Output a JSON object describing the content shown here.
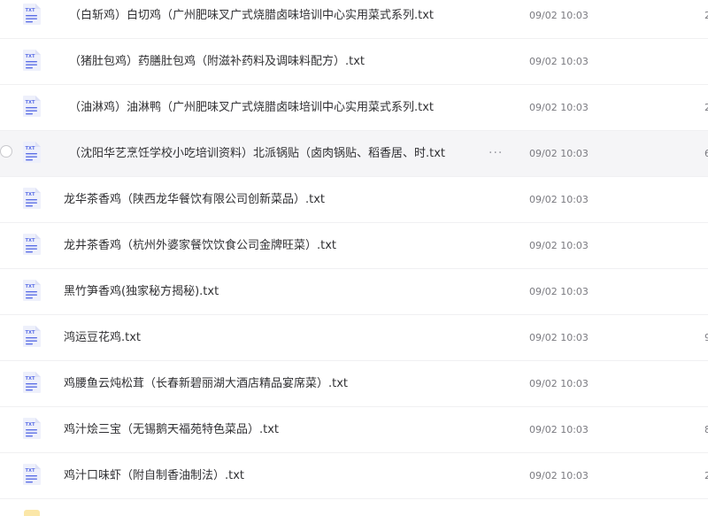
{
  "file_type_label": "TXT",
  "colors": {
    "icon_bg": "#eef0fb",
    "icon_accent": "#5b6ee6",
    "hover_bg": "#f5f5f7"
  },
  "more_glyph": "···",
  "files": [
    {
      "name": "（白斩鸡）白切鸡（广州肥味叉广式烧腊卤味培训中心实用菜式系列.txt",
      "time": "09/02 10:03",
      "size": "2"
    },
    {
      "name": "（猪肚包鸡）药膳肚包鸡（附滋补药料及调味料配方）.txt",
      "time": "09/02 10:03",
      "size": ""
    },
    {
      "name": "（油淋鸡）油淋鸭（广州肥味叉广式烧腊卤味培训中心实用菜式系列.txt",
      "time": "09/02 10:03",
      "size": "2"
    },
    {
      "name": "（沈阳华艺烹饪学校小吃培训资料）北派锅贴（卤肉锅贴、稻香居、时.txt",
      "time": "09/02 10:03",
      "size": "6"
    },
    {
      "name": "龙华茶香鸡（陕西龙华餐饮有限公司创新菜品）.txt",
      "time": "09/02 10:03",
      "size": ""
    },
    {
      "name": "龙井茶香鸡（杭州外婆家餐饮饮食公司金牌旺菜）.txt",
      "time": "09/02 10:03",
      "size": ""
    },
    {
      "name": "黑竹笋香鸡(独家秘方揭秘).txt",
      "time": "09/02 10:03",
      "size": ""
    },
    {
      "name": "鸿运豆花鸡.txt",
      "time": "09/02 10:03",
      "size": "9"
    },
    {
      "name": "鸡腰鱼云炖松茸（长春新碧丽湖大酒店精品宴席菜）.txt",
      "time": "09/02 10:03",
      "size": ""
    },
    {
      "name": "鸡汁烩三宝（无锡鹅天福苑特色菜品）.txt",
      "time": "09/02 10:03",
      "size": "8"
    },
    {
      "name": "鸡汁口味虾（附自制香油制法）.txt",
      "time": "09/02 10:03",
      "size": "2"
    }
  ]
}
